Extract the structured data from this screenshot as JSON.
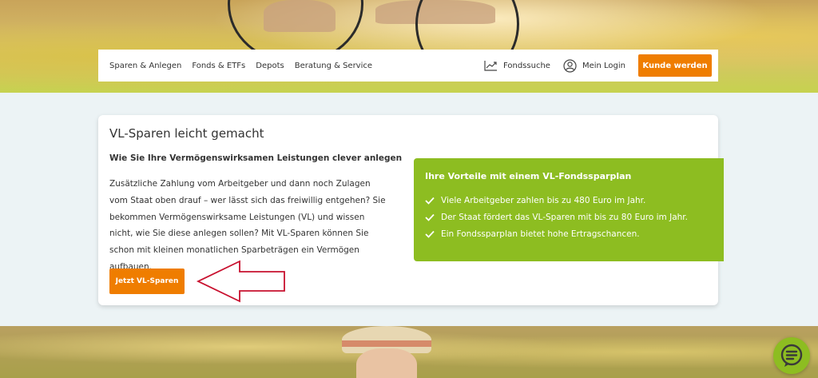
{
  "nav": {
    "links": [
      "Sparen & Anlegen",
      "Fonds & ETFs",
      "Depots",
      "Beratung & Service"
    ],
    "fondssuche": "Fondssuche",
    "login": "Mein Login",
    "cta": "Kunde werden"
  },
  "card": {
    "title": "VL-Sparen leicht gemacht",
    "subtitle": "Wie Sie Ihre Vermögenswirksamen Leistungen clever anlegen",
    "body": "Zusätzliche Zahlung vom Arbeitgeber und dann noch Zulagen vom Staat oben drauf – wer lässt sich das freiwillig entgehen? Sie bekommen Vermögenswirksame Leistungen (VL) und wissen nicht, wie Sie diese anlegen sollen? Mit VL-Sparen können Sie schon mit kleinen monatlichen Sparbeträgen ein Vermögen aufbauen.",
    "button": "Jetzt VL-Sparen"
  },
  "benefits": {
    "title": "Ihre Vorteile mit einem VL-Fondssparplan",
    "items": [
      "Viele Arbeitgeber zahlen bis zu 480 Euro im Jahr.",
      "Der Staat fördert das VL-Sparen mit bis zu 80 Euro im Jahr.",
      "Ein Fondssparplan bietet hohe Ertragschancen."
    ]
  },
  "colors": {
    "accent_orange": "#ef7d00",
    "accent_green": "#8dbd21",
    "annotation_red": "#c8102e"
  },
  "icons": {
    "fondssuche": "chart-trend-icon",
    "login": "user-circle-icon",
    "check": "check-icon",
    "chat": "chat-icon"
  }
}
